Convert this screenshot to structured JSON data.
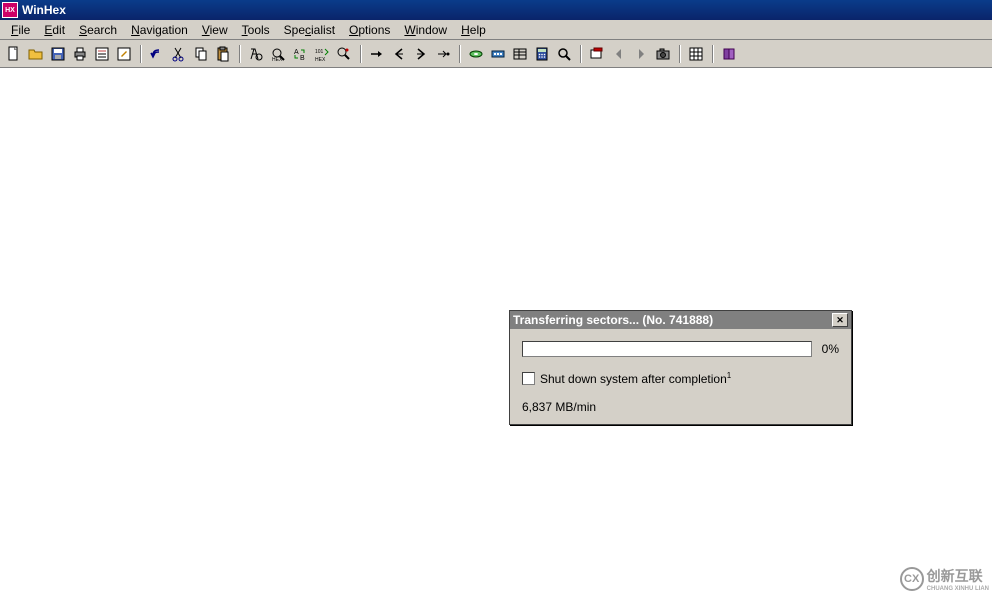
{
  "app": {
    "title": "WinHex"
  },
  "menu": {
    "file": "File",
    "edit": "Edit",
    "search": "Search",
    "navigation": "Navigation",
    "view": "View",
    "tools": "Tools",
    "specialist": "Specialist",
    "options": "Options",
    "window": "Window",
    "help": "Help"
  },
  "toolbar": {
    "new": "new-file",
    "open": "open-file",
    "save": "save",
    "print": "print",
    "props": "properties",
    "writable": "toggle-writable",
    "undo": "undo",
    "cut": "cut",
    "copy": "copy",
    "paste": "paste",
    "find": "find",
    "find_hex": "find-hex",
    "replace": "replace",
    "replace_hex": "replace-hex",
    "find_again": "find-again",
    "goto": "goto",
    "back": "back",
    "forward": "forward",
    "next": "next",
    "disk_open": "open-disk",
    "ram_open": "open-ram",
    "templates": "data-interpreter",
    "calc": "calculator",
    "analyze": "analyze",
    "position_mgr": "position-manager",
    "prev_arrow": "previous",
    "next_arrow": "next-item",
    "camera": "snapshot",
    "options_btn": "general-options",
    "help_btn": "help"
  },
  "dialog": {
    "title": "Transferring sectors... (No. 741888)",
    "percent": "0%",
    "shutdown_label": "Shut down system after completion",
    "superscript": "1",
    "rate": "6,837 MB/min"
  },
  "watermark": {
    "text": "创新互联",
    "sub": "CHUANG XINHU LIAN"
  }
}
